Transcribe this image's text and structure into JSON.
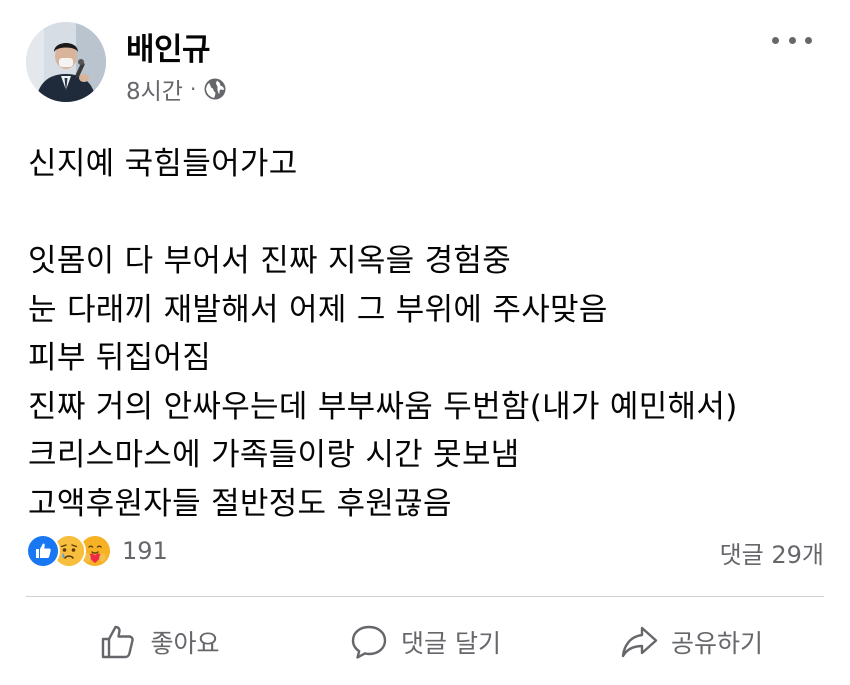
{
  "post": {
    "author_name": "배인규",
    "time": "8시간",
    "separator": "·",
    "privacy_icon": "globe-icon",
    "lines": [
      "신지예 국힘들어가고",
      "",
      "잇몸이 다 부어서 진짜 지옥을 경험중",
      "눈 다래끼 재발해서 어제 그 부위에 주사맞음",
      "피부 뒤집어짐",
      "진짜 거의 안싸우는데 부부싸움 두번함(내가 예민해서)",
      "크리스마스에 가족들이랑 시간 못보냄",
      "고액후원자들 절반정도 후원끊음"
    ]
  },
  "reactions": {
    "icons": [
      "like-reaction",
      "sad-reaction",
      "care-reaction"
    ],
    "count": "191"
  },
  "comments": {
    "count_label": "댓글 29개"
  },
  "actions": {
    "like_label": "좋아요",
    "comment_label": "댓글 달기",
    "share_label": "공유하기"
  },
  "colors": {
    "secondary_text": "#65676b",
    "primary_text": "#050505",
    "like_blue": "#1877f2",
    "divider": "#ced0d4"
  }
}
